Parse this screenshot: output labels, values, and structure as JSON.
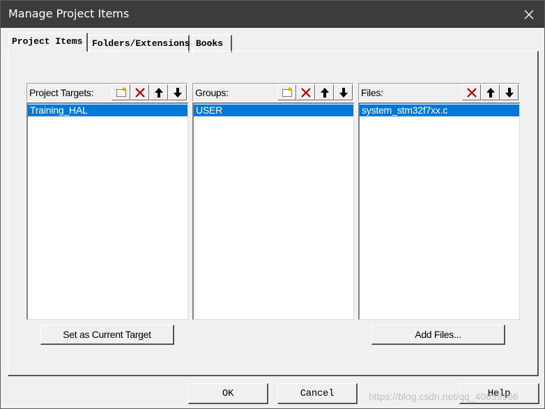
{
  "window": {
    "title": "Manage Project Items"
  },
  "tabs": [
    {
      "label": "Project Items"
    },
    {
      "label": "Folders/Extensions"
    },
    {
      "label": "Books"
    }
  ],
  "panels": {
    "targets": {
      "label": "Project Targets:",
      "items": [
        "Training_HAL"
      ]
    },
    "groups": {
      "label": "Groups:",
      "items": [
        "USER"
      ]
    },
    "files": {
      "label": "Files:",
      "items": [
        "system_stm32f7xx.c"
      ]
    }
  },
  "buttons": {
    "set_target": "Set as Current Target",
    "add_files": "Add Files...",
    "ok": "OK",
    "cancel": "Cancel",
    "help": "Help"
  },
  "watermark": "https://blog.csdn.net/qq_40839966",
  "icons": {
    "new": "new-item-icon",
    "delete": "delete-icon",
    "up": "move-up-icon",
    "down": "move-down-icon",
    "close": "close-icon"
  },
  "colors": {
    "titlebar": "#3c3c3c",
    "selection": "#0078d7",
    "delete_x": "#b00000"
  }
}
